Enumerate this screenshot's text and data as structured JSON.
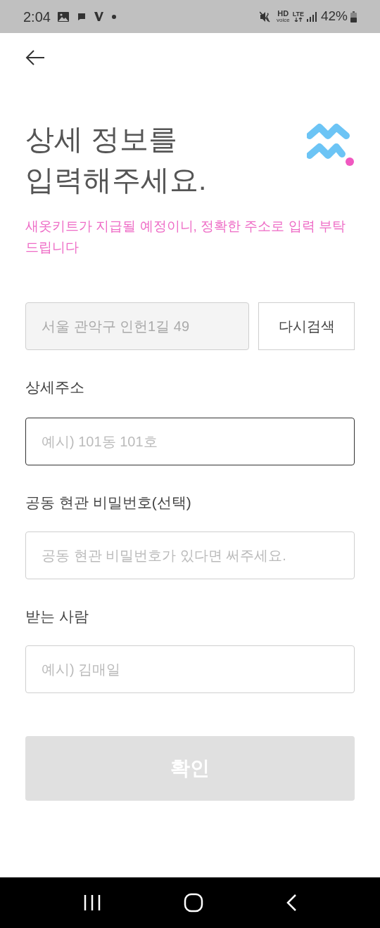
{
  "status_bar": {
    "time": "2:04",
    "hd": "HD",
    "voice": "voice",
    "lte": "LTE",
    "battery": "42%"
  },
  "title": "상세 정보를\n입력해주세요.",
  "notice": "새옷키트가 지급될 예정이니, 정확한 주소로 입력 부탁 드립니다",
  "address": {
    "value": "서울 관악구 인헌1길 49",
    "disabled": true,
    "search_button": "다시검색"
  },
  "fields": [
    {
      "label": "상세주소",
      "placeholder": "예시) 101동 101호",
      "focused": true
    },
    {
      "label": "공동 현관 비밀번호(선택)",
      "placeholder": "공동 현관 비밀번호가 있다면 써주세요.",
      "focused": false
    },
    {
      "label": "받는 사람",
      "placeholder": "예시) 김매일",
      "focused": false
    }
  ],
  "confirm_button": {
    "label": "확인",
    "disabled": true
  }
}
